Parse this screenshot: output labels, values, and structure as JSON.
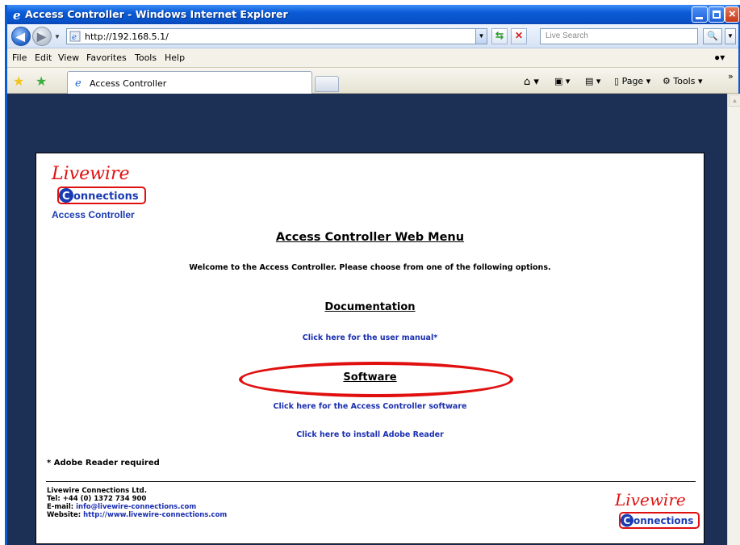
{
  "window": {
    "title": "Access Controller - Windows Internet Explorer"
  },
  "address": {
    "url": "http://192.168.5.1/",
    "search_placeholder": "Live Search"
  },
  "menu": {
    "items": [
      "File",
      "Edit",
      "View",
      "Favorites",
      "Tools",
      "Help"
    ]
  },
  "tab": {
    "label": "Access Controller"
  },
  "toolbar": {
    "page_label": "Page",
    "tools_label": "Tools"
  },
  "page": {
    "logo_text": "Livewire",
    "logo_sub": "onnections",
    "logo_letter": "C",
    "subtitle": "Access Controller",
    "heading": "Access Controller Web Menu",
    "welcome": "Welcome to the Access Controller. Please choose from one of the following options.",
    "doc_heading": "Documentation",
    "manual_link": "Click here for the user manual*",
    "software_heading": "Software",
    "software_link": "Click here for the Access Controller software",
    "adobe_link": "Click here to install Adobe Reader",
    "note": "* Adobe Reader required",
    "footer": {
      "company": "Livewire Connections Ltd.",
      "tel": "Tel: +44 (0) 1372 734 900",
      "email_label": "E-mail: ",
      "email": "info@livewire-connections.com",
      "website_label": "Website: ",
      "website": "http://www.livewire-connections.com"
    }
  },
  "colors": {
    "brand_red": "#e01010",
    "link_blue": "#1a2fb0",
    "background": "#1c2f55"
  }
}
